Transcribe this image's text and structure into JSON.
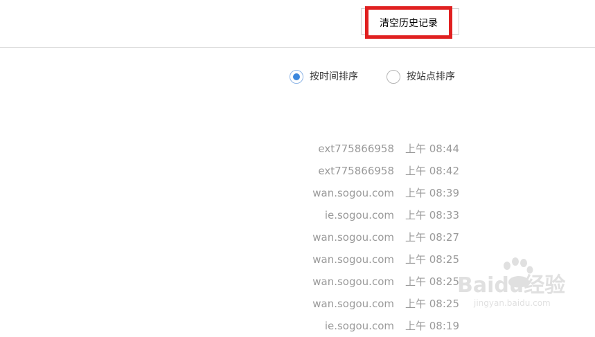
{
  "toolbar": {
    "clear_history_label": "清空历史记录"
  },
  "sort_options": [
    {
      "label": "按时间排序",
      "selected": true
    },
    {
      "label": "按站点排序",
      "selected": false
    }
  ],
  "history": [
    {
      "site": "ext775866958",
      "time": "上午 08:44"
    },
    {
      "site": "ext775866958",
      "time": "上午 08:42"
    },
    {
      "site": "wan.sogou.com",
      "time": "上午 08:39"
    },
    {
      "site": "ie.sogou.com",
      "time": "上午 08:33"
    },
    {
      "site": "wan.sogou.com",
      "time": "上午 08:27"
    },
    {
      "site": "wan.sogou.com",
      "time": "上午 08:25"
    },
    {
      "site": "wan.sogou.com",
      "time": "上午 08:25"
    },
    {
      "site": "wan.sogou.com",
      "time": "上午 08:25"
    },
    {
      "site": "ie.sogou.com",
      "time": "上午 08:19"
    }
  ],
  "watermark": {
    "brand": "Baidu经验",
    "url": "jingyan.baidu.com"
  },
  "colors": {
    "accent": "#3b87dd",
    "highlight": "#e02020",
    "muted_text": "#9a9a9a"
  }
}
